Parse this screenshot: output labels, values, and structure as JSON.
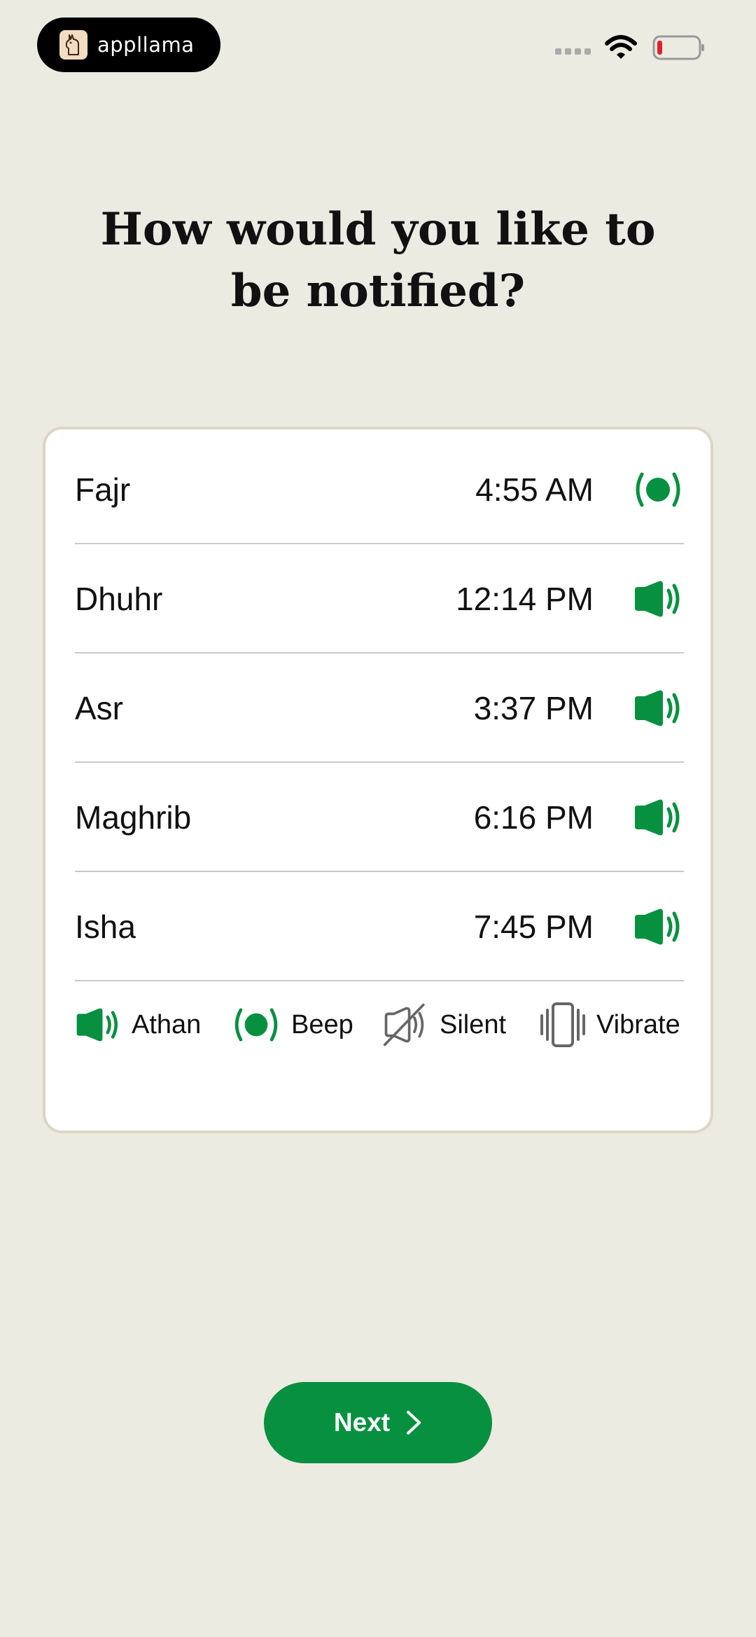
{
  "status_bar": {
    "brand_name": "appllama"
  },
  "title": {
    "line1": "How would you like to",
    "line2": "be notified?"
  },
  "prayers": [
    {
      "name": "Fajr",
      "time": "4:55 AM",
      "mode": "beep"
    },
    {
      "name": "Dhuhr",
      "time": "12:14 PM",
      "mode": "athan"
    },
    {
      "name": "Asr",
      "time": "3:37 PM",
      "mode": "athan"
    },
    {
      "name": "Maghrib",
      "time": "6:16 PM",
      "mode": "athan"
    },
    {
      "name": "Isha",
      "time": "7:45 PM",
      "mode": "athan"
    }
  ],
  "legend": {
    "athan": "Athan",
    "beep": "Beep",
    "silent": "Silent",
    "vibrate": "Vibrate"
  },
  "next_button": {
    "label": "Next"
  },
  "colors": {
    "accent": "#06903f",
    "background": "#ecebe2",
    "battery_low": "#e0202a"
  }
}
